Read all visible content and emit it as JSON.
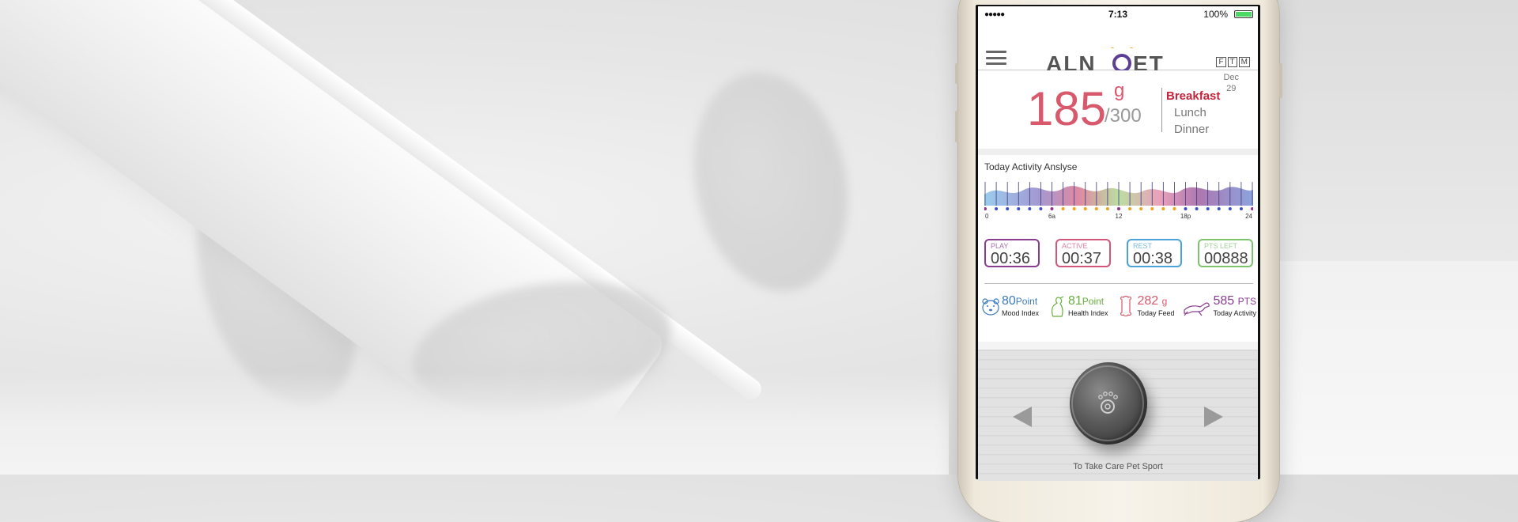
{
  "status_bar": {
    "signal": "●●●●●",
    "time": "7:13",
    "battery": "100%",
    "battery_level": 1.0
  },
  "header": {
    "logo_text": "ALNPET",
    "ftm": [
      "F",
      "T",
      "M"
    ]
  },
  "feed": {
    "amount": "185",
    "unit": "g",
    "total": "/300",
    "meals": [
      {
        "label": "Breakfast",
        "active": true
      },
      {
        "label": "Lunch",
        "active": false
      },
      {
        "label": "Dinner",
        "active": false
      }
    ],
    "date_month": "Dec",
    "date_day": "29"
  },
  "activity": {
    "title": "Today Activity Anslyse",
    "axis_labels": [
      "0",
      "6a",
      "12",
      "18p",
      "24"
    ],
    "stats": [
      {
        "label": "PLAY",
        "value": "00:36",
        "color": "#8a3d8f"
      },
      {
        "label": "ACTIVE",
        "value": "00:37",
        "color": "#d1567a"
      },
      {
        "label": "REST",
        "value": "00:38",
        "color": "#4aa3d6"
      },
      {
        "label": "PTS LEFT",
        "value": "00888",
        "color": "#7cc36c"
      }
    ],
    "indices": [
      {
        "value": "80",
        "unit": "Point",
        "label": "Mood Index",
        "color": "#3c7bbf",
        "icon": "bear-face-icon"
      },
      {
        "value": "81",
        "unit": "Point",
        "label": "Health Index",
        "color": "#6aae3e",
        "icon": "dog-sitting-icon"
      },
      {
        "value": "282",
        "unit": "g",
        "label": "Today Feed",
        "color": "#d8586c",
        "icon": "bone-icon"
      },
      {
        "value": "585",
        "unit": "PTS",
        "label": "Today Activity",
        "color": "#8a3d8f",
        "icon": "dog-running-icon"
      }
    ]
  },
  "promo": {
    "caption": "To Take Care Pet Sport"
  },
  "colors": {
    "accent_red": "#d8586c",
    "breakfast_red": "#c8233b",
    "battery_green": "#4cd964"
  }
}
